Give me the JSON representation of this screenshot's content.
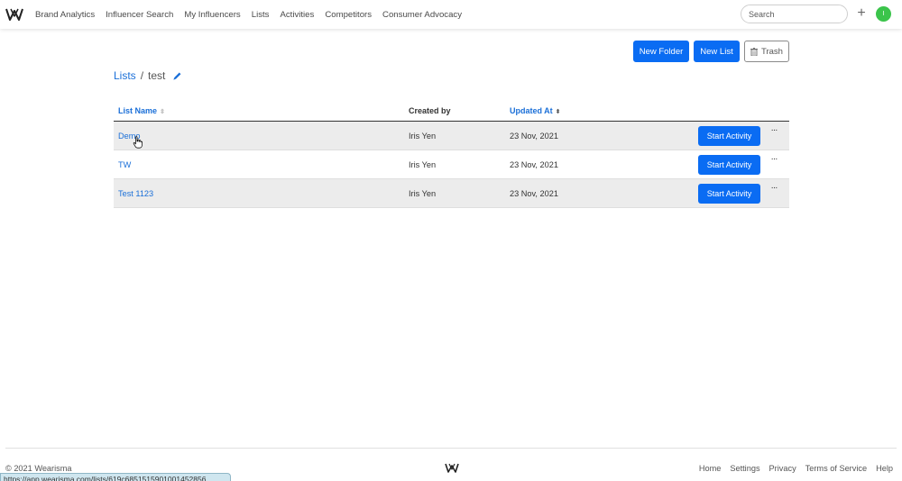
{
  "nav": {
    "items": [
      {
        "label": "Brand Analytics"
      },
      {
        "label": "Influencer Search"
      },
      {
        "label": "My Influencers"
      },
      {
        "label": "Lists"
      },
      {
        "label": "Activities"
      },
      {
        "label": "Competitors"
      },
      {
        "label": "Consumer Advocacy"
      }
    ],
    "search_placeholder": "Search",
    "plus_label": "+",
    "avatar_initial": "I"
  },
  "actions": {
    "new_folder": "New Folder",
    "new_list": "New List",
    "trash": "Trash"
  },
  "breadcrumb": {
    "root": "Lists",
    "separator": "/",
    "current": "test"
  },
  "table": {
    "headers": {
      "list_name": "List Name",
      "created_by": "Created by",
      "updated_at": "Updated At"
    },
    "rows": [
      {
        "name": "Demo",
        "created_by": "Iris Yen",
        "updated_at": "23 Nov, 2021",
        "action": "Start Activity",
        "more": "···"
      },
      {
        "name": "TW",
        "created_by": "Iris Yen",
        "updated_at": "23 Nov, 2021",
        "action": "Start Activity",
        "more": "···"
      },
      {
        "name": "Test 1123",
        "created_by": "Iris Yen",
        "updated_at": "23 Nov, 2021",
        "action": "Start Activity",
        "more": "···"
      }
    ]
  },
  "footer": {
    "copyright": "© 2021 Wearisma",
    "links": [
      "Home",
      "Settings",
      "Privacy",
      "Terms of Service",
      "Help"
    ],
    "status_url": "https://app.wearisma.com/lists/619c6851515901001452856"
  },
  "colors": {
    "primary": "#0a6cf3",
    "link": "#1a6fd8",
    "avatar": "#3bc44b",
    "stripe": "#ececec"
  }
}
